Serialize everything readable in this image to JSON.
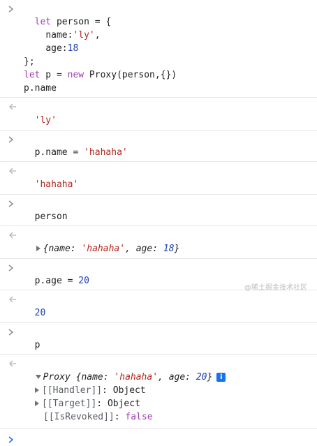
{
  "console": {
    "entry1": {
      "kw_let": "let",
      "var_person": " person = {",
      "line2_key": "name:",
      "line2_val": "'ly'",
      "line2_comma": ",",
      "line3_key": "age:",
      "line3_val": "18",
      "line4": "};",
      "line5_kw": "let",
      "line5_mid": " p = ",
      "line5_new": "new",
      "line5_rest": " Proxy(person,{})",
      "line6": "p.name"
    },
    "result1": "'ly'",
    "entry2": {
      "left": "p.name = ",
      "str": "'hahaha'"
    },
    "result2": "'hahaha'",
    "entry3": "person",
    "result3": {
      "open": "{",
      "k1": "name: ",
      "v1": "'hahaha'",
      "sep": ", ",
      "k2": "age: ",
      "v2": "18",
      "close": "}"
    },
    "entry4": {
      "left": "p.age = ",
      "num": "20"
    },
    "result4": "20",
    "entry5": "p",
    "result5": {
      "proxy_label": "Proxy ",
      "open": "{",
      "k1": "name: ",
      "v1": "'hahaha'",
      "sep": ", ",
      "k2": "age: ",
      "v2": "20",
      "close": "}",
      "info": "i",
      "children": [
        {
          "key": "[[Handler]]",
          "sep": ": ",
          "value": "Object"
        },
        {
          "key": "[[Target]]",
          "sep": ": ",
          "value": "Object"
        },
        {
          "key": "[[IsRevoked]]",
          "sep": ": ",
          "value": "false"
        }
      ]
    }
  },
  "watermark": "@稀土掘金技术社区"
}
